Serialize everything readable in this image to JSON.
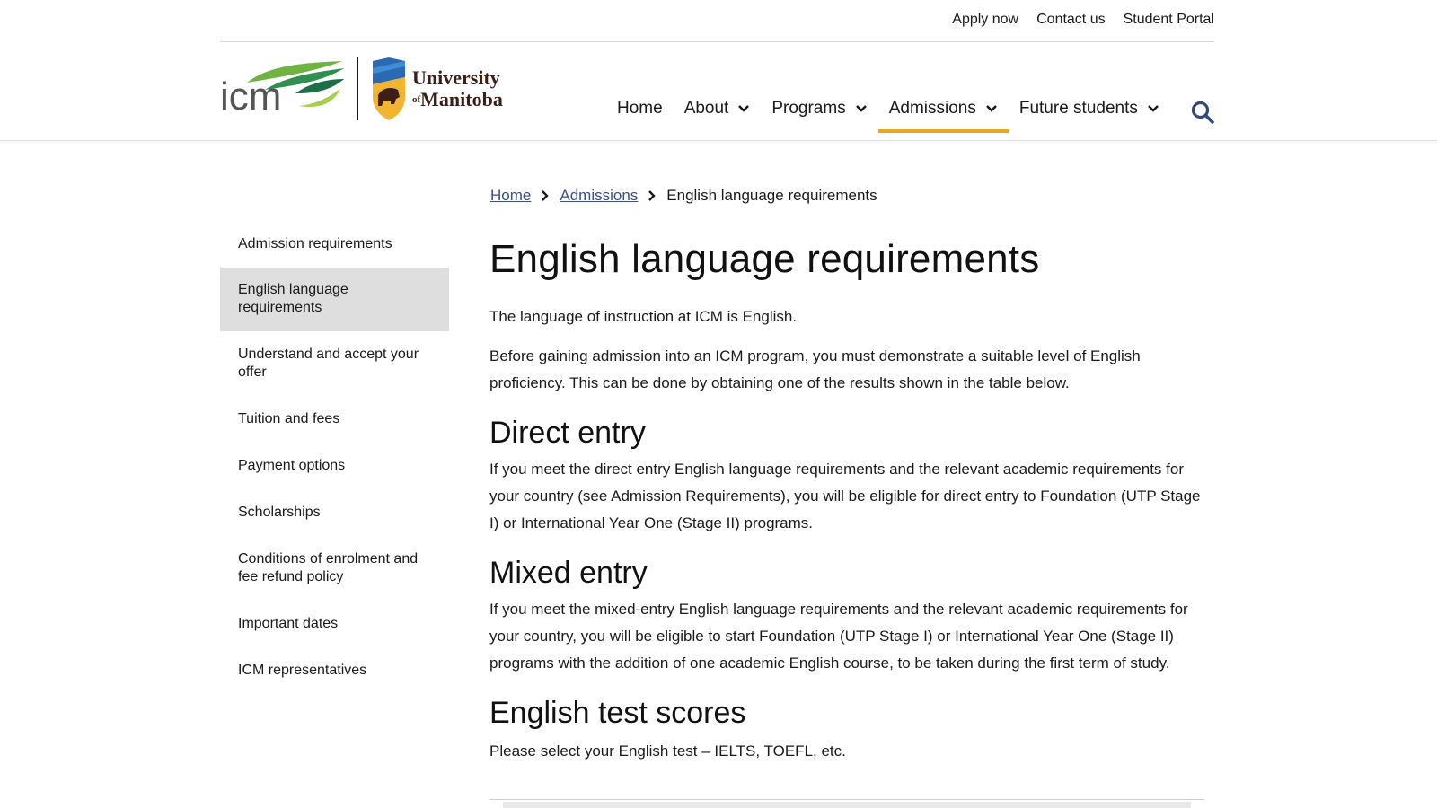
{
  "utility": {
    "links": [
      "Apply now",
      "Contact us",
      "Student Portal"
    ]
  },
  "logos": {
    "icm_text": "icm",
    "um_line1": "University",
    "um_of": "of",
    "um_line2": "Manitoba"
  },
  "nav": {
    "items": [
      {
        "label": "Home",
        "dropdown": false
      },
      {
        "label": "About",
        "dropdown": true
      },
      {
        "label": "Programs",
        "dropdown": true
      },
      {
        "label": "Admissions",
        "dropdown": true,
        "active": true
      },
      {
        "label": "Future students",
        "dropdown": true
      }
    ],
    "search_icon": "search-icon",
    "active_color": "#e8a822"
  },
  "breadcrumb": {
    "items": [
      "Home",
      "Admissions"
    ],
    "current": "English language requirements"
  },
  "sidebar": {
    "items": [
      "Admission requirements",
      "English language requirements",
      "Understand and accept your offer",
      "Tuition and fees",
      "Payment options",
      "Scholarships",
      "Conditions of enrolment and fee refund policy",
      "Important dates",
      "ICM representatives"
    ],
    "active_index": 1
  },
  "content": {
    "title": "English language requirements",
    "intro": "The language of instruction at ICM is English.",
    "gain": "Before gaining admission into an ICM program, you must demonstrate a suitable level of English proficiency. This can be done by obtaining one of the results shown in the table below.",
    "direct_heading": "Direct entry",
    "direct_text": "If you meet the direct entry English language requirements and the relevant academic requirements for your country (see Admission Requirements), you will be eligible for direct entry to Foundation (UTP Stage I) or International Year One (Stage II) programs.",
    "mixed_heading": "Mixed entry",
    "mixed_text": "If you meet the mixed-entry English language requirements and the relevant academic requirements for your country, you will be eligible to start Foundation (UTP Stage I) or International Year One (Stage II) programs with the addition of one academic English course, to be taken during the first term of study.",
    "test_heading": "English test scores",
    "test_text": "Please select your English test – IELTS, TOEFL, etc."
  },
  "colors": {
    "link": "#3c4f86",
    "active_sidebar_bg": "#dedede",
    "accent": "#e8a822",
    "search": "#2f4a7c"
  }
}
